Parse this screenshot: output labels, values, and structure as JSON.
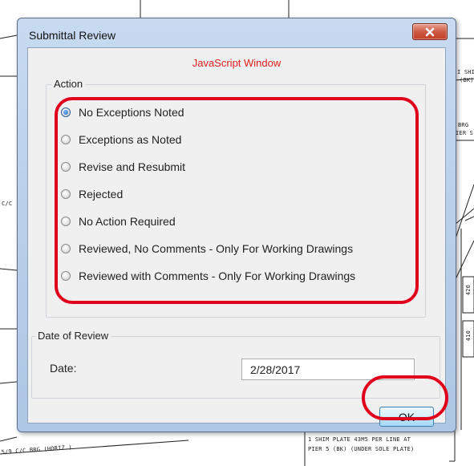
{
  "window": {
    "title": "Submittal Review",
    "subtitle": "JavaScript Window"
  },
  "action_group": {
    "legend": "Action",
    "options": [
      {
        "label": "No Exceptions Noted",
        "selected": true
      },
      {
        "label": "Exceptions as Noted",
        "selected": false
      },
      {
        "label": "Revise and Resubmit",
        "selected": false
      },
      {
        "label": "Rejected",
        "selected": false
      },
      {
        "label": "No Action Required",
        "selected": false
      },
      {
        "label": "Reviewed, No Comments - Only For Working Drawings",
        "selected": false
      },
      {
        "label": "Reviewed with Comments - Only For Working Drawings",
        "selected": false
      }
    ]
  },
  "date_group": {
    "legend": "Date of Review",
    "date_label": "Date:",
    "date_value": "2/28/2017"
  },
  "buttons": {
    "ok": "OK"
  },
  "background_text": {
    "shim_top_1": "I SHI",
    "shim_top_2": "(BK)",
    "brg_1": "BRG",
    "brg_2": "IER S",
    "left_mark": "C/C",
    "dim_1": "420",
    "dim_2": "410",
    "bottom_left": "5/9 C/C BRG (HORIZ.)",
    "bottom_right_1": "1 SHIM PLATE 43M5 PER LINE AT",
    "bottom_right_2": "PIER 5 (BK) (UNDER SOLE PLATE)"
  },
  "colors": {
    "accent_red": "#e0001b",
    "subtitle_red": "#e02020",
    "close_button": "#c23f26"
  }
}
